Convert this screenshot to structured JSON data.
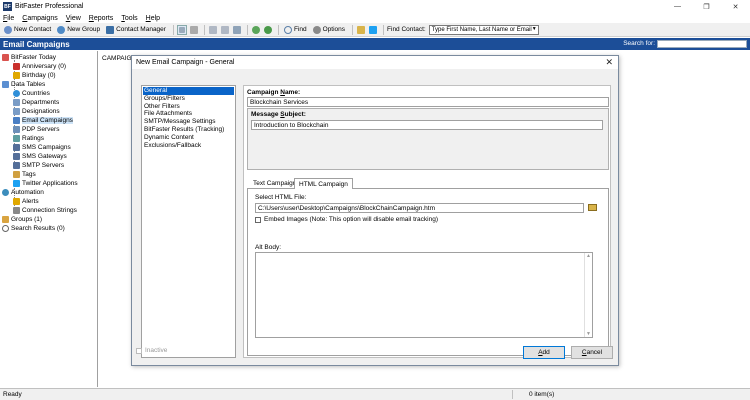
{
  "window": {
    "app_title": "BitFaster Professional",
    "icon_label": "BF",
    "minimize": "—",
    "maximize": "❐",
    "close": "✕"
  },
  "menu": [
    {
      "ul": "F",
      "rest": "ile"
    },
    {
      "ul": "C",
      "rest": "ampaigns"
    },
    {
      "ul": "V",
      "rest": "iew"
    },
    {
      "ul": "R",
      "rest": "eports"
    },
    {
      "ul": "T",
      "rest": "ools"
    },
    {
      "ul": "H",
      "rest": "elp"
    }
  ],
  "toolbar": {
    "new_contact": "New Contact",
    "new_group": "New Group",
    "contact_manager": "Contact Manager",
    "find": "Find",
    "options": "Options",
    "find_contact_label": "Find Contact:",
    "find_contact_value": "Type First Name, Last Name or Email",
    "dropdown_arrow": "▼"
  },
  "header": {
    "title": "Email Campaigns",
    "search_label": "Search for:",
    "search_value": ""
  },
  "sidebar": {
    "items": [
      {
        "label": "BitFaster Today",
        "icon": "calendar-icon",
        "color": "#d9534f"
      },
      {
        "label": "Anniversary (0)",
        "icon": "anniversary-icon",
        "color": "#c9302c"
      },
      {
        "label": "Birthday (0)",
        "icon": "birthday-icon",
        "color": "#e0a800"
      },
      {
        "label": "Data Tables",
        "icon": "table-icon",
        "color": "#5b8fd1"
      },
      {
        "label": "Countries",
        "icon": "globe-icon",
        "color": "#2f8fd8"
      },
      {
        "label": "Departments",
        "icon": "departments-icon",
        "color": "#7a9cc6"
      },
      {
        "label": "Designations",
        "icon": "designations-icon",
        "color": "#7a9cc6"
      },
      {
        "label": "Email Campaigns",
        "icon": "email-icon",
        "color": "#4a7fc4"
      },
      {
        "label": "PDP Servers",
        "icon": "server-icon",
        "color": "#6c8fb8"
      },
      {
        "label": "Ratings",
        "icon": "ratings-icon",
        "color": "#5f9ea0"
      },
      {
        "label": "SMS Campaigns",
        "icon": "sms-icon",
        "color": "#556f99"
      },
      {
        "label": "SMS Gateways",
        "icon": "gateway-icon",
        "color": "#556f99"
      },
      {
        "label": "SMTP Servers",
        "icon": "smtp-icon",
        "color": "#556f99"
      },
      {
        "label": "Tags",
        "icon": "tag-icon",
        "color": "#d0a040"
      },
      {
        "label": "Twitter Applications",
        "icon": "twitter-icon",
        "color": "#1da1f2"
      },
      {
        "label": "Automation",
        "icon": "gear-icon",
        "color": "#3c8dbc"
      },
      {
        "label": "Alerts",
        "icon": "alert-icon",
        "color": "#e0a800"
      },
      {
        "label": "Connection Strings",
        "icon": "connection-icon",
        "color": "#888"
      },
      {
        "label": "Groups (1)",
        "icon": "groups-icon",
        "color": "#d9a441"
      },
      {
        "label": "Search Results (0)",
        "icon": "search-icon",
        "color": "#666"
      }
    ]
  },
  "main": {
    "column_header": "CAMPAIGN"
  },
  "dialog": {
    "title": "New Email Campaign - General",
    "close": "✕",
    "nav": [
      "General",
      "Groups/Filters",
      "Other Filters",
      "File Attachments",
      "SMTP/Message Settings",
      "BitFaster Results (Tracking)",
      "Dynamic Content",
      "Exclusions/Fallback"
    ],
    "campaign_name_label_pre": "Campaign ",
    "campaign_name_label_ul": "N",
    "campaign_name_label_post": "ame:",
    "campaign_name_value": "Blockchain Services",
    "message_subject_label_pre": "Message ",
    "message_subject_label_ul": "S",
    "message_subject_label_post": "ubject:",
    "message_subject_value": "Introduction to Blockchain",
    "tabs": [
      "Text Campaign",
      "HTML Campaign"
    ],
    "select_html_label": "Select HTML File:",
    "html_file_path": "C:\\Users\\user\\Desktop\\Campaigns\\BlockChainCampaign.htm",
    "embed_images_label": "Embed Images (Note: This option will disable email tracking)",
    "alt_body_label": "Alt Body:",
    "inactive_label": "Inactive",
    "add_ul": "A",
    "add_rest": "dd",
    "cancel_ul": "C",
    "cancel_rest": "ancel"
  },
  "status": {
    "left": "Ready",
    "right": "0 item(s)"
  }
}
